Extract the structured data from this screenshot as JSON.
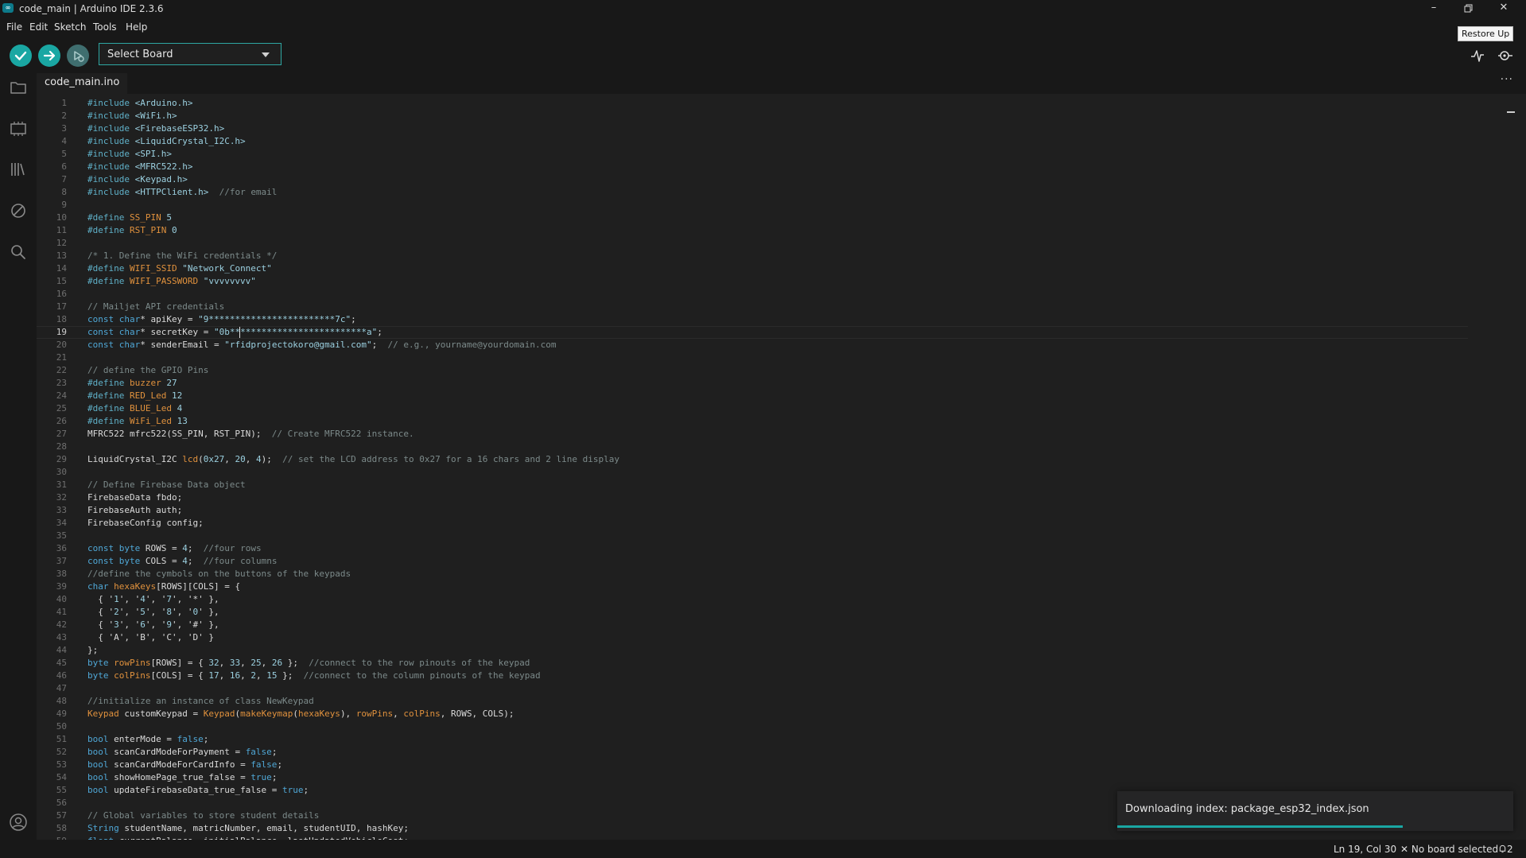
{
  "app": {
    "title": "code_main | Arduino IDE 2.3.6",
    "tooltip": "Restore Up"
  },
  "menu": [
    "File",
    "Edit",
    "Sketch",
    "Tools",
    "Help"
  ],
  "toolbar": {
    "board_select": "Select Board"
  },
  "tab": {
    "filename": "code_main.ino",
    "more": "···"
  },
  "editor": {
    "line_numbers": [
      "1",
      "2",
      "3",
      "4",
      "5",
      "6",
      "7",
      "8",
      "9",
      "10",
      "11",
      "12",
      "13",
      "14",
      "15",
      "16",
      "17",
      "18",
      "19",
      "20",
      "21",
      "22",
      "23",
      "24",
      "25",
      "26",
      "27",
      "28",
      "29",
      "30",
      "31",
      "32",
      "33",
      "34",
      "35",
      "36",
      "37",
      "38",
      "39",
      "40",
      "41",
      "42",
      "43",
      "44",
      "45",
      "46",
      "47",
      "48",
      "49",
      "50",
      "51",
      "52",
      "53",
      "54",
      "55",
      "56",
      "57",
      "58",
      "59"
    ],
    "current_line": 19,
    "lines": [
      "#include <Arduino.h>",
      "#include <WiFi.h>",
      "#include <FirebaseESP32.h>",
      "#include <LiquidCrystal_I2C.h>",
      "#include <SPI.h>",
      "#include <MFRC522.h>",
      "#include <Keypad.h>",
      "#include <HTTPClient.h>  //for email",
      "",
      "#define SS_PIN 5",
      "#define RST_PIN 0",
      "",
      "/* 1. Define the WiFi credentials */",
      "#define WIFI_SSID \"Network_Connect\"",
      "#define WIFI_PASSWORD \"vvvvvvvv\"",
      "",
      "// Mailjet API credentials",
      "const char* apiKey = \"9************************7c\";",
      "const char* secretKey = \"0b**************************a\";",
      "const char* senderEmail = \"rfidprojectokoro@gmail.com\";  // e.g., yourname@yourdomain.com",
      "",
      "// define the GPIO Pins",
      "#define buzzer 27",
      "#define RED_Led 12",
      "#define BLUE_Led 4",
      "#define WiFi_Led 13",
      "MFRC522 mfrc522(SS_PIN, RST_PIN);  // Create MFRC522 instance.",
      "",
      "LiquidCrystal_I2C lcd(0x27, 20, 4);  // set the LCD address to 0x27 for a 16 chars and 2 line display",
      "",
      "// Define Firebase Data object",
      "FirebaseData fbdo;",
      "FirebaseAuth auth;",
      "FirebaseConfig config;",
      "",
      "const byte ROWS = 4;  //four rows",
      "const byte COLS = 4;  //four columns",
      "//define the cymbols on the buttons of the keypads",
      "char hexaKeys[ROWS][COLS] = {",
      "  { '1', '4', '7', '*' },",
      "  { '2', '5', '8', '0' },",
      "  { '3', '6', '9', '#' },",
      "  { 'A', 'B', 'C', 'D' }",
      "};",
      "byte rowPins[ROWS] = { 32, 33, 25, 26 };  //connect to the row pinouts of the keypad",
      "byte colPins[COLS] = { 17, 16, 2, 15 };  //connect to the column pinouts of the keypad",
      "",
      "//initialize an instance of class NewKeypad",
      "Keypad customKeypad = Keypad(makeKeymap(hexaKeys), rowPins, colPins, ROWS, COLS);",
      "",
      "bool enterMode = false;",
      "bool scanCardModeForPayment = false;",
      "bool scanCardModeForCardInfo = false;",
      "bool showHomePage_true_false = true;",
      "bool updateFirebaseData_true_false = true;",
      "",
      "// Global variables to store student details",
      "String studentName, matricNumber, email, studentUID, hashKey;",
      "float currentBalance, initialBalance, lastUpdatedVehicleCost;"
    ]
  },
  "notification": {
    "text": "Downloading index: package_esp32_index.json",
    "progress": 0.72
  },
  "status": {
    "position": "Ln 19, Col 30",
    "board": "No board selected",
    "notifications": "2"
  },
  "colors": {
    "accent": "#1aa7a3",
    "background": "#1f1f1f",
    "chrome": "#181818"
  }
}
